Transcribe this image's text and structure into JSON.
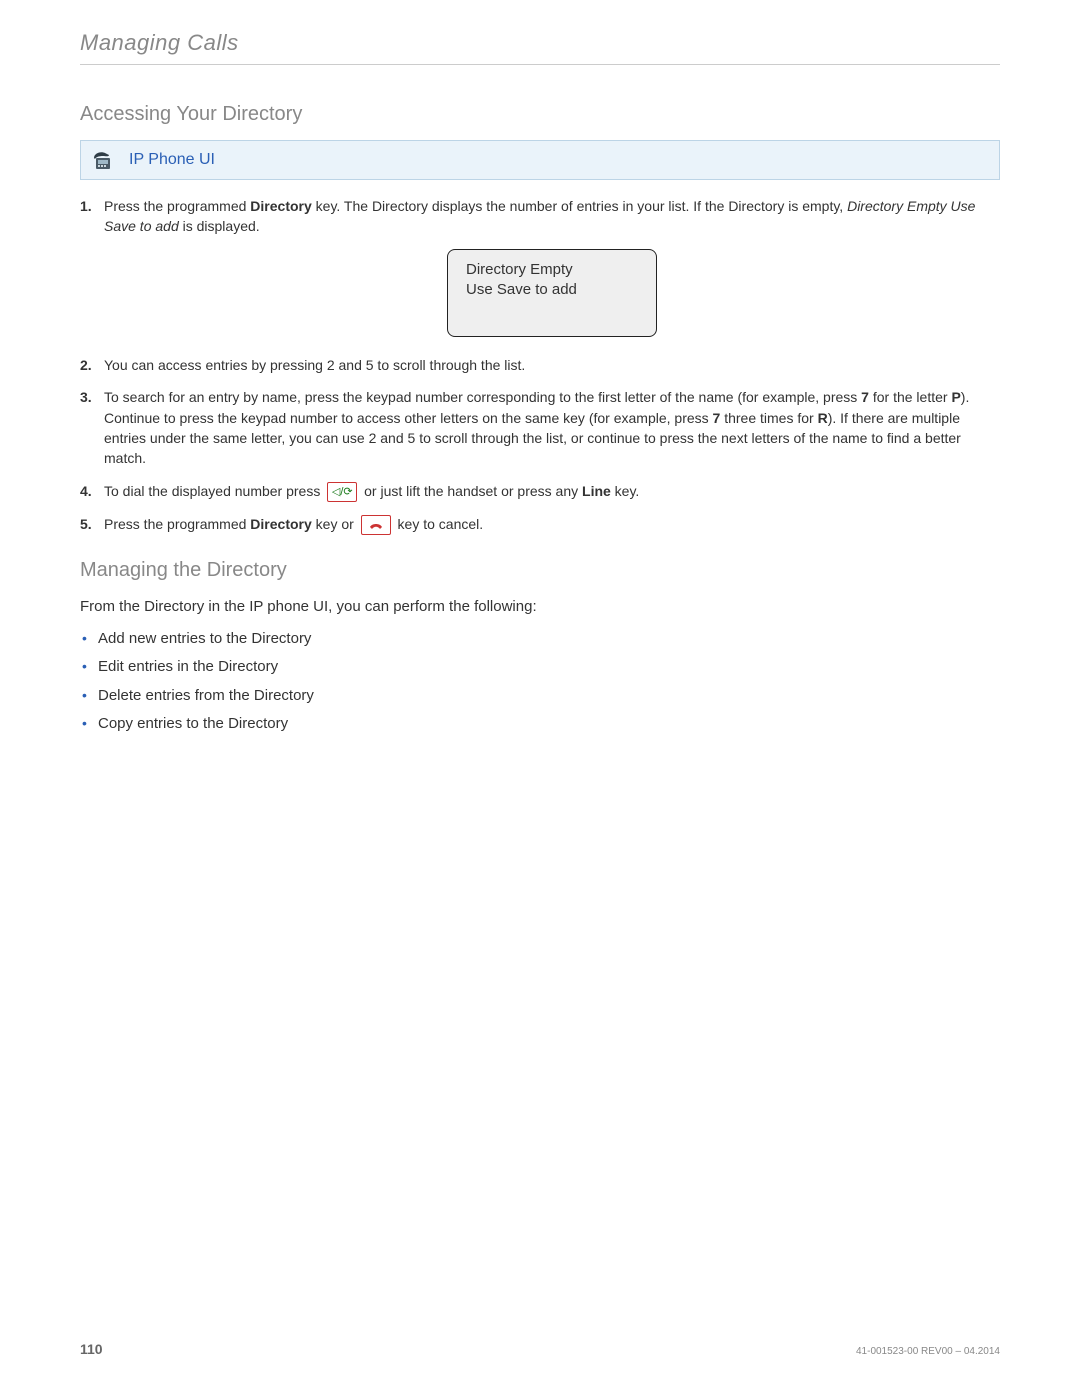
{
  "running_head": "Managing Calls",
  "section1_title": "Accessing Your Directory",
  "callout_label": "IP Phone UI",
  "steps": {
    "s1_a": "Press the programmed ",
    "s1_b": "Directory",
    "s1_c": " key. The Directory displays the number of entries in your list. If the Directory is empty, ",
    "s1_d": "Directory Empty Use Save to add",
    "s1_e": " is displayed.",
    "display_line1": "Directory Empty",
    "display_line2": "Use Save to add",
    "s2": "You can access entries by pressing 2 and 5 to scroll through the list.",
    "s3_a": "To search for an entry by name, press the keypad number corresponding to the first letter of the name (for example, press ",
    "s3_b": "7",
    "s3_c": " for the letter ",
    "s3_d": "P",
    "s3_e": "). Continue to press the keypad number to access other letters on the same key (for example, press ",
    "s3_f": "7",
    "s3_g": " three times for ",
    "s3_h": "R",
    "s3_i": "). If there are multiple entries under the same letter, you can use 2 and 5 to scroll through the list, or continue to press the next letters of the name to find a better match.",
    "s4_a": "To dial the displayed number press ",
    "s4_b": " or just lift the handset or press any ",
    "s4_c": "Line",
    "s4_d": " key.",
    "s5_a": "Press the programmed ",
    "s5_b": "Directory",
    "s5_c": " key or ",
    "s5_d": " key to cancel."
  },
  "section2_title": "Managing the Directory",
  "section2_intro": "From the Directory in the IP phone UI, you can perform the following:",
  "bullets": [
    "Add new entries to the Directory",
    "Edit entries in the Directory",
    "Delete entries from the Directory",
    "Copy entries to the Directory"
  ],
  "footer_page": "110",
  "footer_doc": "41-001523-00 REV00 – 04.2014"
}
